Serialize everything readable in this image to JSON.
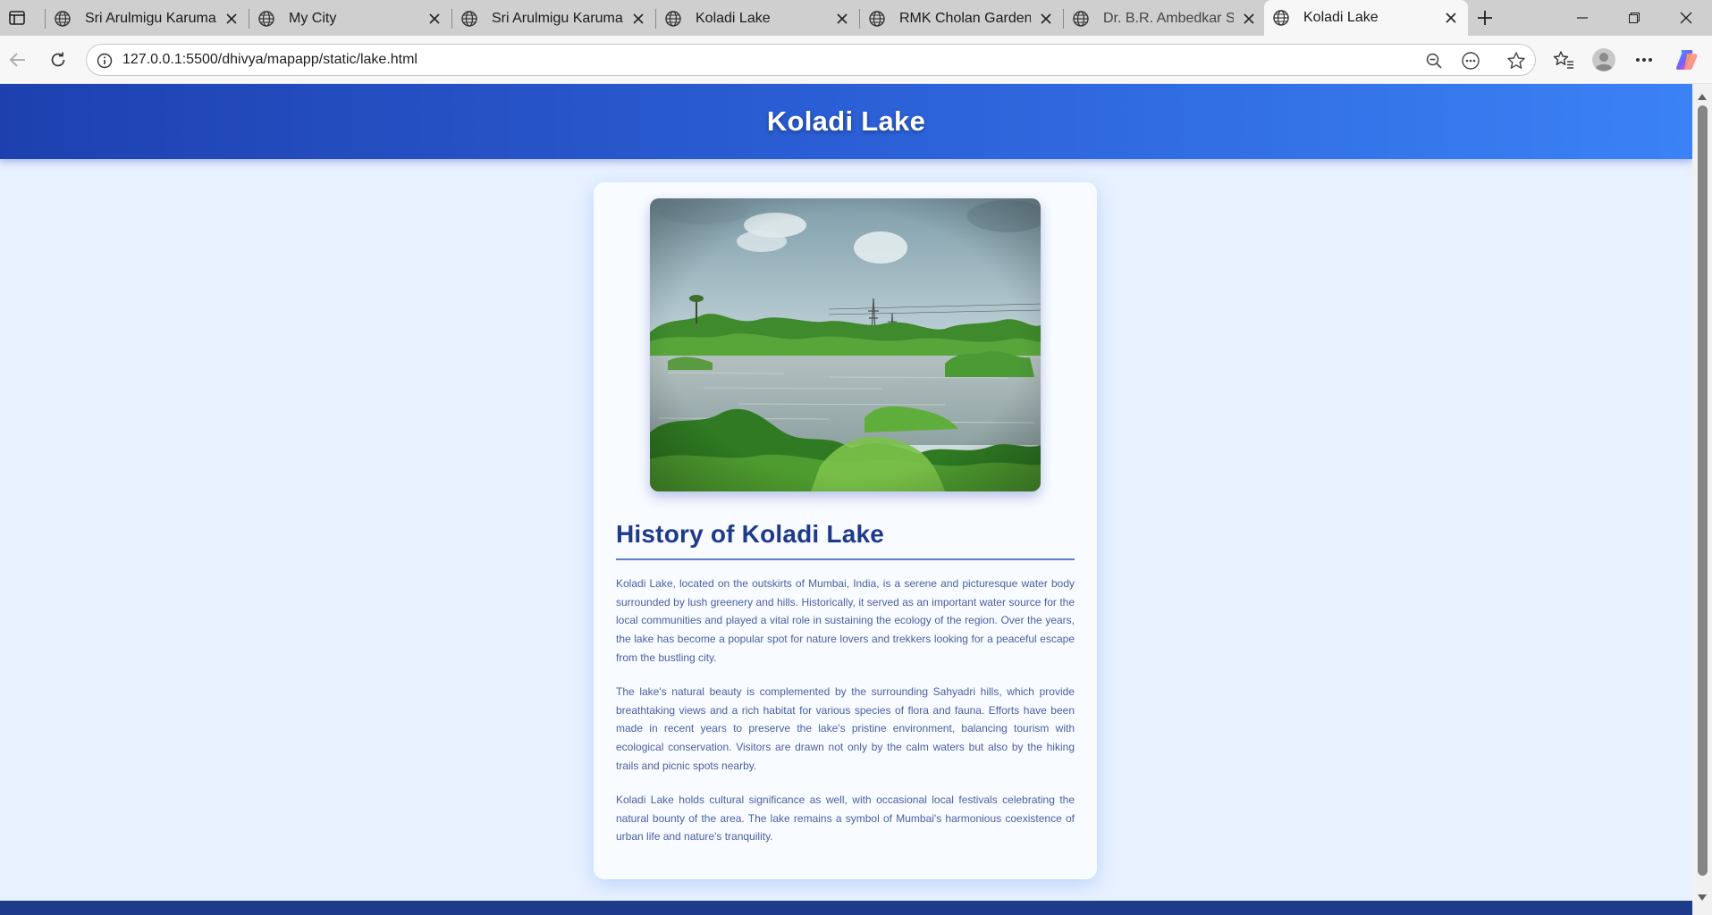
{
  "browser": {
    "tabs": [
      {
        "title": "Sri Arulmigu Karumari",
        "active": false
      },
      {
        "title": "My City",
        "active": false
      },
      {
        "title": "Sri Arulmigu Karumari",
        "active": false
      },
      {
        "title": "Koladi Lake",
        "active": false
      },
      {
        "title": "RMK Cholan Garden",
        "active": false
      },
      {
        "title": "Dr. B.R. Ambedkar Stat",
        "active": false
      },
      {
        "title": "Koladi Lake",
        "active": true
      }
    ],
    "url": "127.0.0.1:5500/dhivya/mapapp/static/lake.html",
    "icons": {
      "tab_favicon": "globe-icon",
      "close": "close-icon",
      "new_tab": "plus-icon"
    }
  },
  "page": {
    "header_title": "Koladi Lake",
    "image_alt": "Koladi Lake photo",
    "section_title": "History of Koladi Lake",
    "paragraphs": [
      "Koladi Lake, located on the outskirts of Mumbai, India, is a serene and picturesque water body surrounded by lush greenery and hills. Historically, it served as an important water source for the local communities and played a vital role in sustaining the ecology of the region. Over the years, the lake has become a popular spot for nature lovers and trekkers looking for a peaceful escape from the bustling city.",
      "The lake's natural beauty is complemented by the surrounding Sahyadri hills, which provide breathtaking views and a rich habitat for various species of flora and fauna. Efforts have been made in recent years to preserve the lake's pristine environment, balancing tourism with ecological conservation. Visitors are drawn not only by the calm waters but also by the hiking trails and picnic spots nearby.",
      "Koladi Lake holds cultural significance as well, with occasional local festivals celebrating the natural bounty of the area. The lake remains a symbol of Mumbai's harmonious coexistence of urban life and nature's tranquility."
    ]
  },
  "colors": {
    "header_gradient_start": "#1e40af",
    "header_gradient_end": "#3b82f6",
    "heading": "#1e3a8a",
    "body_text": "#4a5fa0",
    "page_background": "#e8f1ff"
  }
}
